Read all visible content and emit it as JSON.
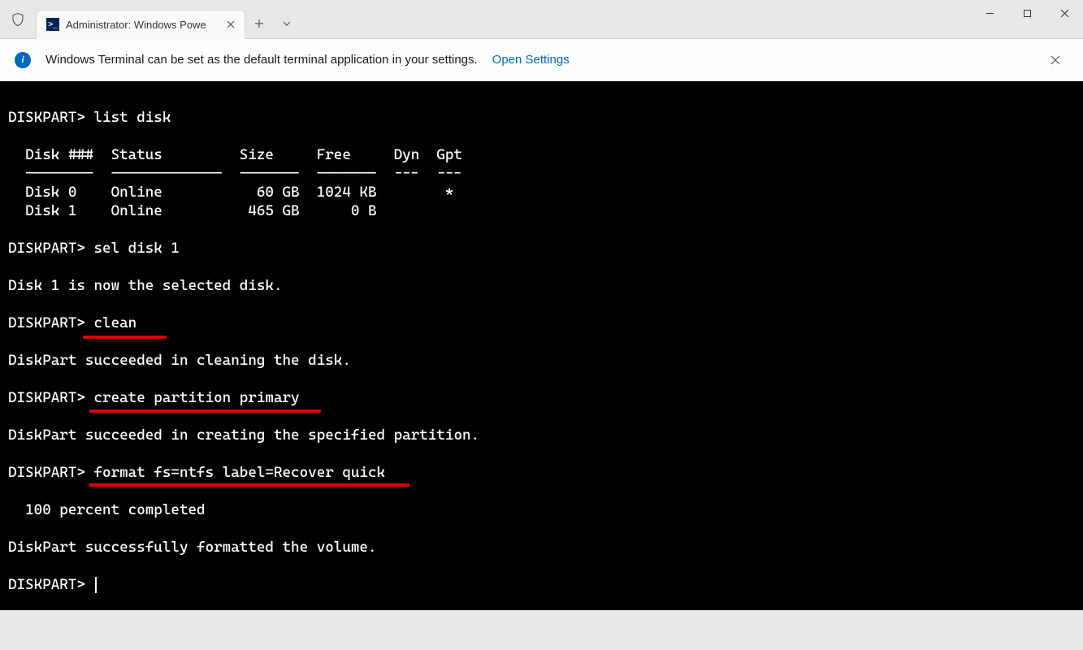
{
  "window": {
    "tab_title": "Administrator: Windows Powe"
  },
  "infobar": {
    "text": "Windows Terminal can be set as the default terminal application in your settings.",
    "link": "Open Settings"
  },
  "terminal": {
    "lines": [
      "",
      "DISKPART> list disk",
      "",
      "  Disk ###  Status         Size     Free     Dyn  Gpt",
      "  --------  -------------  -------  -------  ---  ---",
      "  Disk 0    Online           60 GB  1024 KB        *",
      "  Disk 1    Online          465 GB      0 B",
      "",
      "DISKPART> sel disk 1",
      "",
      "Disk 1 is now the selected disk.",
      "",
      "DISKPART> clean",
      "",
      "DiskPart succeeded in cleaning the disk.",
      "",
      "DISKPART> create partition primary",
      "",
      "DiskPart succeeded in creating the specified partition.",
      "",
      "DISKPART> format fs=ntfs label=Recover quick",
      "",
      "  100 percent completed",
      "",
      "DiskPart successfully formatted the volume.",
      "",
      "DISKPART> "
    ]
  }
}
